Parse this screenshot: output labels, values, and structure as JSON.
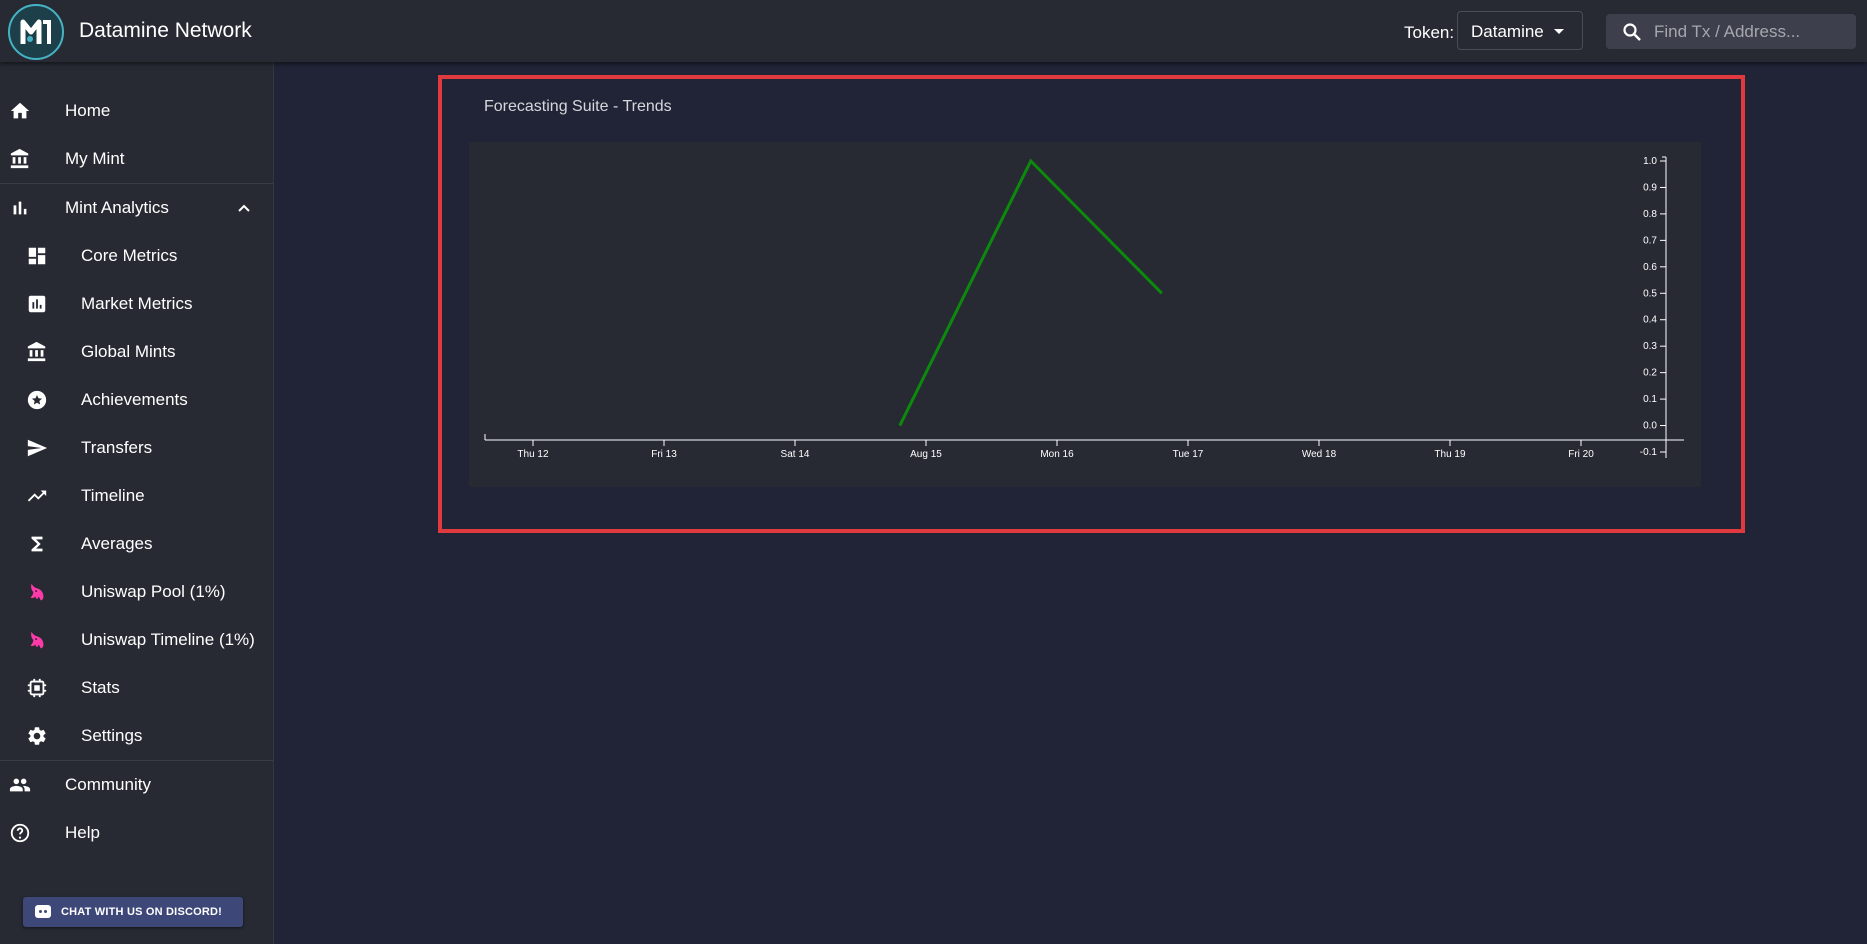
{
  "app": {
    "title": "Datamine Network",
    "token_label": "Token:",
    "token_value": "Datamine",
    "search_placeholder": "Find Tx / Address..."
  },
  "sidebar": {
    "items": [
      {
        "label": "Home",
        "icon": "home-icon"
      },
      {
        "label": "My Mint",
        "icon": "bank-icon"
      },
      {
        "label": "Mint Analytics",
        "icon": "bar-chart-icon",
        "expanded": true
      },
      {
        "label": "Core Metrics",
        "icon": "dashboard-icon"
      },
      {
        "label": "Market Metrics",
        "icon": "assessment-icon"
      },
      {
        "label": "Global Mints",
        "icon": "bank-icon"
      },
      {
        "label": "Achievements",
        "icon": "star-circle-icon"
      },
      {
        "label": "Transfers",
        "icon": "send-icon"
      },
      {
        "label": "Timeline",
        "icon": "trending-up-icon"
      },
      {
        "label": "Averages",
        "icon": "sigma-icon"
      },
      {
        "label": "Uniswap Pool (1%)",
        "icon": "unicorn-icon"
      },
      {
        "label": "Uniswap Timeline (1%)",
        "icon": "unicorn-icon"
      },
      {
        "label": "Stats",
        "icon": "chip-icon"
      },
      {
        "label": "Settings",
        "icon": "gear-icon"
      },
      {
        "label": "Community",
        "icon": "people-icon"
      },
      {
        "label": "Help",
        "icon": "help-circle-icon"
      }
    ],
    "discord_button": "CHAT WITH US ON DISCORD!"
  },
  "colors": {
    "accent_highlight": "#e03a3e",
    "series_line": "#0c8a0c",
    "uniswap_pink": "#ff3aa8"
  },
  "main": {
    "card_title": "Forecasting Suite - Trends"
  },
  "chart_data": {
    "type": "line",
    "title": "",
    "xlabel": "",
    "ylabel": "",
    "x_ticks": [
      "Thu 12",
      "Fri 13",
      "Sat 14",
      "Aug 15",
      "Mon 16",
      "Tue 17",
      "Wed 18",
      "Thu 19",
      "Fri 20"
    ],
    "y_ticks": [
      "1.0",
      "0.9",
      "0.8",
      "0.7",
      "0.6",
      "0.5",
      "0.4",
      "0.3",
      "0.2",
      "0.1",
      "0.0",
      "-0.1"
    ],
    "ylim": [
      -0.1,
      1.0
    ],
    "y_axis_position": "right",
    "grid": false,
    "series": [
      {
        "x": [
          2.8,
          3.8,
          4.8
        ],
        "values": [
          0.0,
          1.0,
          0.5
        ]
      }
    ]
  }
}
